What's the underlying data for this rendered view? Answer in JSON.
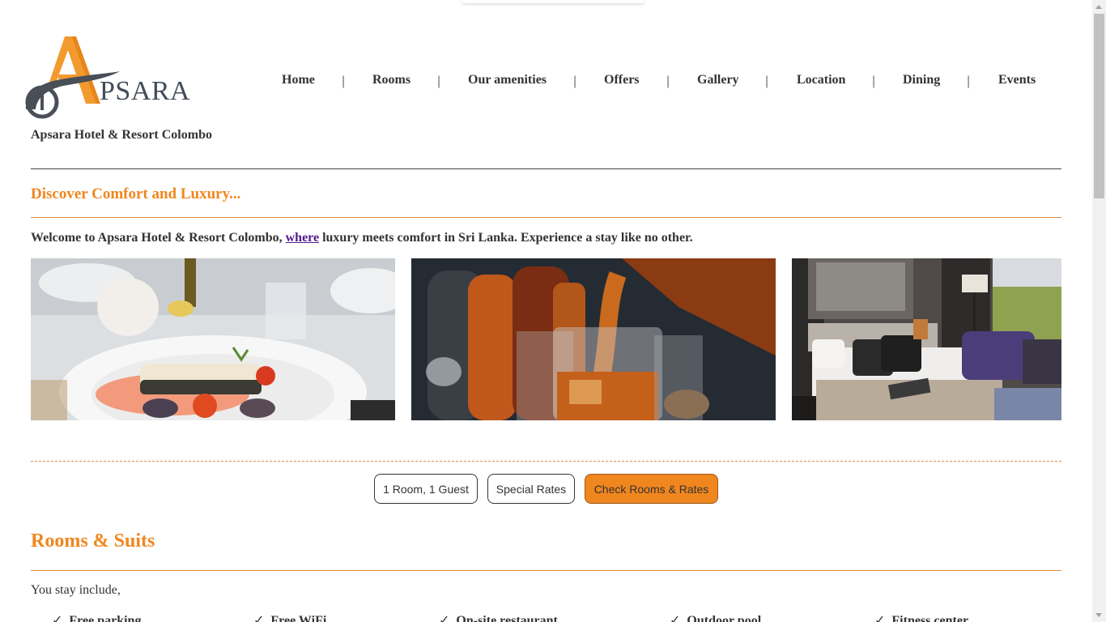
{
  "brand": {
    "logo_text": "PSARA",
    "logo_initial": "A",
    "hotel_name": "Apsara Hotel & Resort Colombo"
  },
  "nav": {
    "items": [
      "Home",
      "Rooms",
      "Our amenities",
      "Offers",
      "Gallery",
      "Location",
      "Dining",
      "Events"
    ],
    "separator": "|"
  },
  "hero": {
    "tagline": "Discover Comfort and Luxury...",
    "welcome_before": "Welcome to Apsara Hotel & Resort Colombo, ",
    "welcome_link": "where",
    "welcome_after": " luxury meets comfort in Sri Lanka. Experience a stay like no other."
  },
  "gallery": {
    "images": [
      "fish-dish-photo",
      "whiskey-pour-photo",
      "hotel-bedroom-photo"
    ]
  },
  "booking": {
    "rooms_guests_label": "1 Room, 1 Guest",
    "special_rates_label": "Special Rates",
    "check_label": "Check Rooms & Rates"
  },
  "rooms": {
    "title": "Rooms & Suits",
    "intro": "You stay include,",
    "amenities": [
      "Free parking",
      "Free WiFi",
      "On-site restaurant",
      "Outdoor pool",
      "Fitness center"
    ],
    "check_glyph": "✓"
  },
  "colors": {
    "accent": "#f0861e",
    "text": "#333333",
    "link_visited": "#551a8b"
  }
}
